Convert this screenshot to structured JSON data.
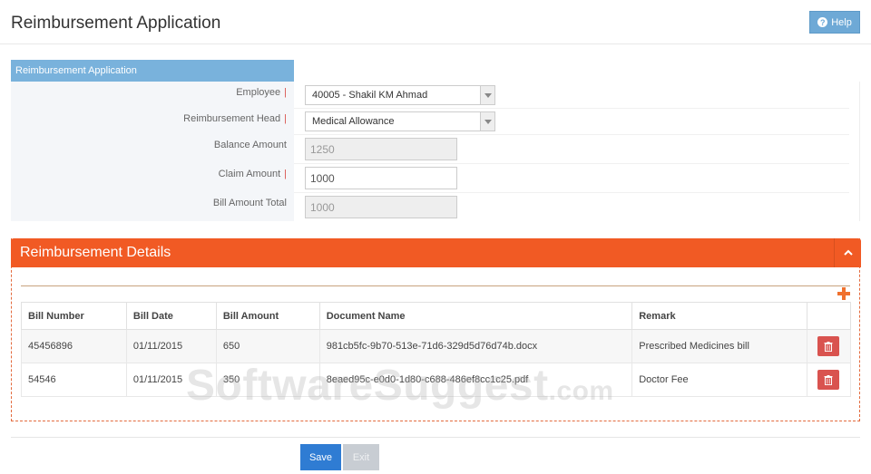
{
  "header": {
    "title": "Reimbursement Application",
    "help_label": "Help"
  },
  "form": {
    "tab_label": "Reimbursement Application",
    "employee_label": "Employee",
    "employee_value": "40005 - Shakil KM Ahmad",
    "head_label": "Reimbursement Head",
    "head_value": "Medical Allowance",
    "balance_label": "Balance Amount",
    "balance_value": "1250",
    "claim_label": "Claim Amount",
    "claim_value": "1000",
    "total_label": "Bill Amount Total",
    "total_value": "1000",
    "required_mark": "|"
  },
  "details": {
    "title": "Reimbursement Details",
    "columns": [
      "Bill Number",
      "Bill Date",
      "Bill Amount",
      "Document Name",
      "Remark"
    ],
    "rows": [
      {
        "bill_number": "45456896",
        "bill_date": "01/11/2015",
        "bill_amount": "650",
        "document_name": "981cb5fc-9b70-513e-71d6-329d5d76d74b.docx",
        "remark": "Prescribed Medicines bill"
      },
      {
        "bill_number": "54546",
        "bill_date": "01/11/2015",
        "bill_amount": "350",
        "document_name": "8eaed95c-e0d0-1d80-c688-486ef8cc1c25.pdf",
        "remark": "Doctor Fee"
      }
    ]
  },
  "actions": {
    "save_label": "Save",
    "exit_label": "Exit"
  },
  "watermark": {
    "main": "SoftwareSuggest",
    "suffix": ".com"
  },
  "colors": {
    "accent_orange": "#f15a24",
    "tab_blue": "#79b2dc",
    "save_blue": "#2f7cd3",
    "delete_red": "#d9534f"
  }
}
